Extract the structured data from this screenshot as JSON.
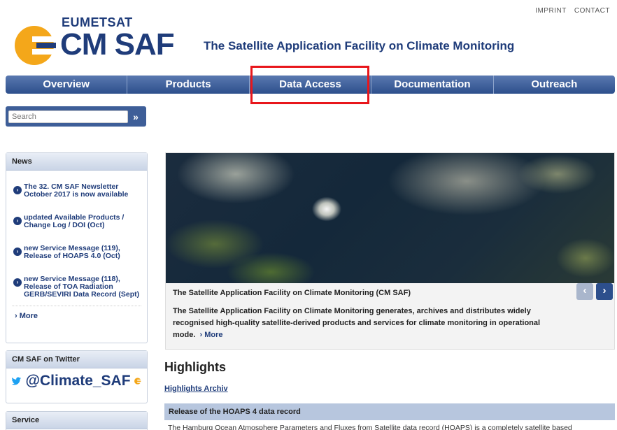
{
  "top_links": {
    "imprint": "IMPRINT",
    "contact": "CONTACT"
  },
  "logo": {
    "org": "EUMETSAT",
    "name": "CM SAF"
  },
  "tagline": "The Satellite Application Facility on Climate Monitoring",
  "nav": [
    {
      "label": "Overview"
    },
    {
      "label": "Products"
    },
    {
      "label": "Data Access"
    },
    {
      "label": "Documentation"
    },
    {
      "label": "Outreach"
    }
  ],
  "search": {
    "placeholder": "Search",
    "button": "»"
  },
  "news": {
    "title": "News",
    "items": [
      {
        "label": "The 32. CM SAF Newsletter October 2017 is now available"
      },
      {
        "label": "updated Available Products / Change Log / DOI (Oct)"
      },
      {
        "label": "new Service Message (119), Release of HOAPS 4.0 (Oct)"
      },
      {
        "label": "new Service Message (118), Release of TOA Radiation GERB/SEVIRI Data Record (Sept)"
      }
    ],
    "more": "More"
  },
  "twitter": {
    "title": "CM SAF on Twitter",
    "handle": "@Climate_SAF"
  },
  "service": {
    "title": "Service"
  },
  "hero": {
    "title": "The Satellite Application Facility on Climate Monitoring (CM SAF)",
    "text": "The Satellite Application Facility on Climate Monitoring generates, archives and distributes widely recognised high-quality satellite-derived products and services for climate monitoring in operational mode.",
    "more": "More"
  },
  "highlights": {
    "title": "Highlights",
    "archiv": "Highlights Archiv",
    "item_title": "Release of the HOAPS 4 data record",
    "item_text": "The Hamburg Ocean Atmosphere Parameters and Fluxes from Satellite data record (HOAPS) is a completely satellite based"
  },
  "colors": {
    "brand_blue": "#1f3c7a",
    "logo_orange": "#f4a71a",
    "annotation_red": "#e8161b"
  }
}
